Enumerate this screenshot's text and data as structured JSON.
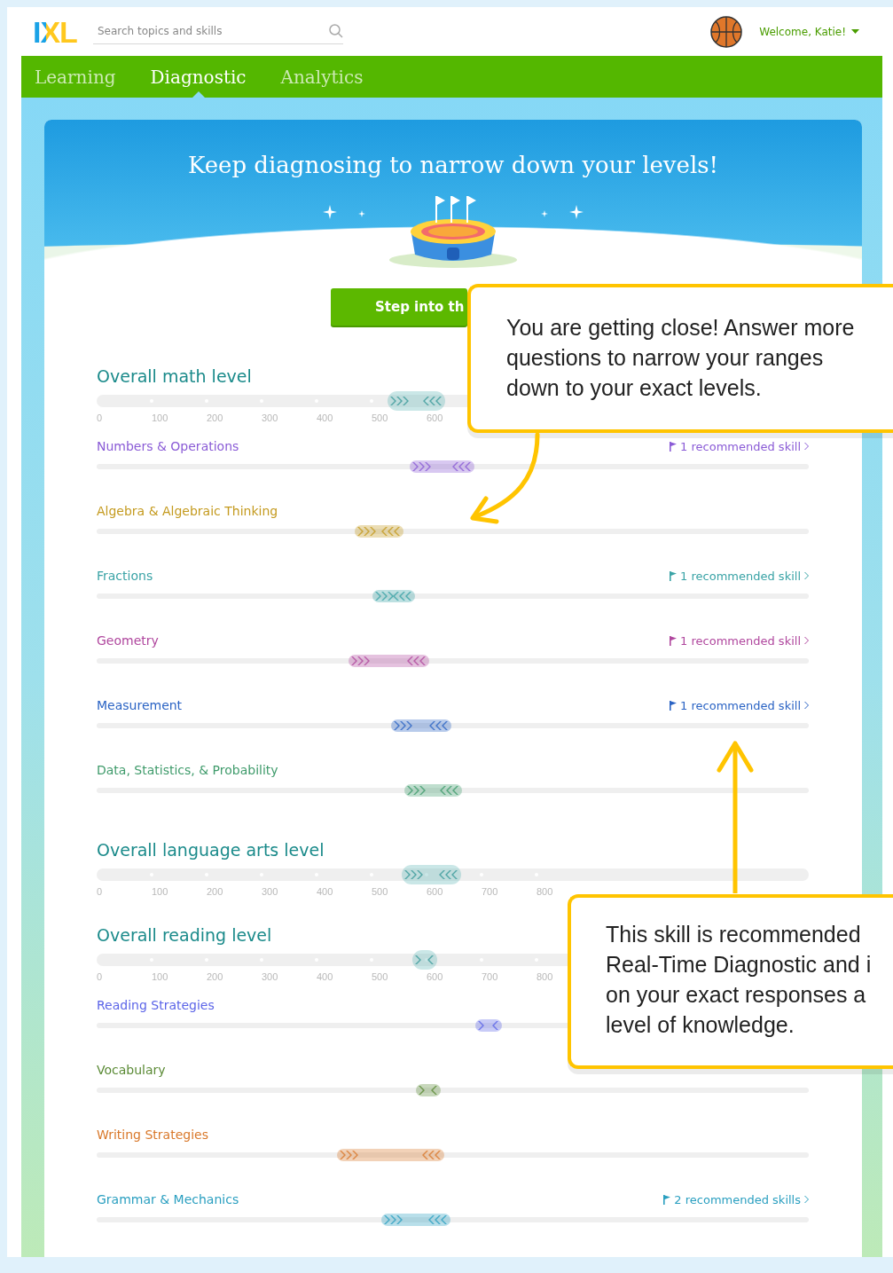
{
  "header": {
    "logo": "IXL",
    "search": {
      "placeholder": "Search topics and skills"
    },
    "welcome": "Welcome, Katie!"
  },
  "nav": [
    {
      "label": "Learning",
      "selected": false
    },
    {
      "label": "Diagnostic",
      "selected": true
    },
    {
      "label": "Analytics",
      "selected": false
    }
  ],
  "hero": {
    "title": "Keep diagnosing to narrow down your levels!",
    "button": "Step into th"
  },
  "rows": [
    {
      "kind": "overall",
      "title": "Overall math level",
      "ticks": [
        "0",
        "100",
        "200",
        "300",
        "400",
        "500",
        "600"
      ],
      "range": {
        "from": {
          "level": 0.409
        },
        "to": {
          "level": 0.49
        }
      }
    },
    {
      "kind": "domain",
      "title": "Numbers & Operations",
      "color": "#8a5bd6",
      "recommended": "1 recommended skill",
      "range": {
        "from": {
          "level": 0.44
        },
        "to": {
          "level": 0.53
        }
      }
    },
    {
      "kind": "domain",
      "title": "Algebra & Algebraic Thinking",
      "color": "#c49a1e",
      "range": {
        "from": {
          "level": 0.362
        },
        "to": {
          "level": 0.431
        }
      }
    },
    {
      "kind": "domain",
      "title": "Fractions",
      "color": "#3aa3a6",
      "recommended": "1 recommended skill",
      "range": {
        "from": {
          "level": 0.387
        },
        "to": {
          "level": 0.447
        }
      }
    },
    {
      "kind": "domain",
      "title": "Geometry",
      "color": "#b0479e",
      "recommended": "1 recommended skill",
      "range": {
        "from": {
          "level": 0.354
        },
        "to": {
          "level": 0.467
        }
      }
    },
    {
      "kind": "domain",
      "title": "Measurement",
      "color": "#2a63c4",
      "recommended": "1 recommended skill",
      "range": {
        "from": {
          "level": 0.413
        },
        "to": {
          "level": 0.498
        }
      }
    },
    {
      "kind": "domain",
      "title": "Data, Statistics, & Probability",
      "color": "#3f9b6b",
      "range": {
        "from": {
          "level": 0.432
        },
        "to": {
          "level": 0.513
        }
      }
    },
    {
      "kind": "overall",
      "title": "Overall language arts level",
      "ticks": [
        "0",
        "100",
        "200",
        "300",
        "400",
        "500",
        "600",
        "700",
        "800"
      ],
      "range": {
        "from": {
          "level": 0.428
        },
        "to": {
          "level": 0.512
        }
      }
    },
    {
      "kind": "overall",
      "title": "Overall reading level",
      "ticks": [
        "0",
        "100",
        "200",
        "300",
        "400",
        "500",
        "600",
        "700",
        "800"
      ],
      "range": {
        "from": {
          "level": 0.443
        },
        "to": {
          "level": 0.478
        }
      }
    },
    {
      "kind": "domain",
      "title": "Reading Strategies",
      "color": "#5b64e8",
      "range": {
        "from": {
          "level": 0.532
        },
        "to": {
          "level": 0.569
        }
      }
    },
    {
      "kind": "domain",
      "title": "Vocabulary",
      "color": "#5a8a35",
      "range": {
        "from": {
          "level": 0.448
        },
        "to": {
          "level": 0.483
        }
      }
    },
    {
      "kind": "domain",
      "title": "Writing Strategies",
      "color": "#d9782a",
      "range": {
        "from": {
          "level": 0.337
        },
        "to": {
          "level": 0.488
        }
      }
    },
    {
      "kind": "domain",
      "title": "Grammar & Mechanics",
      "color": "#2a9fc0",
      "recommended": "2 recommended skills",
      "range": {
        "from": {
          "level": 0.4
        },
        "to": {
          "level": 0.497
        }
      }
    }
  ],
  "callouts": [
    {
      "lines": [
        "You are getting close! Answer more",
        "questions to narrow your ranges",
        "down to your exact levels."
      ]
    },
    {
      "lines": [
        "This skill is recommended",
        "Real-Time Diagnostic and i",
        "on your exact responses a",
        "level of knowledge."
      ]
    }
  ]
}
